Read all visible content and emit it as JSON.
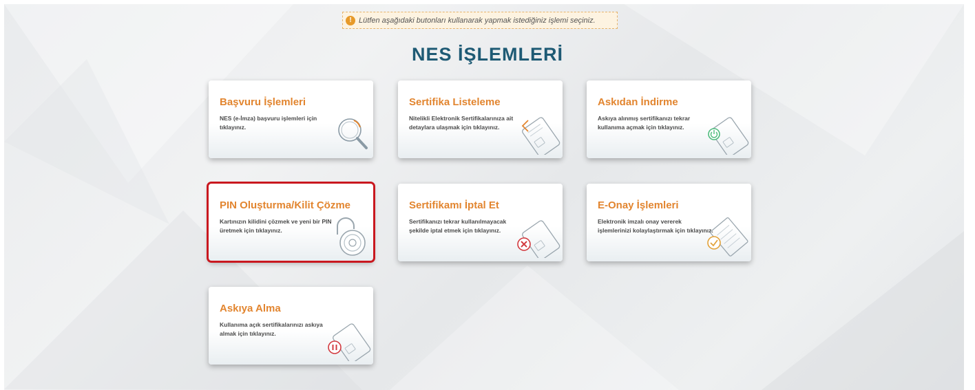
{
  "notice": {
    "text": "Lütfen aşağıdaki butonları kullanarak yapmak istediğiniz işlemi seçiniz.",
    "icon": "info-icon"
  },
  "page_title": "NES İŞLEMLERİ",
  "cards": [
    {
      "title": "Başvuru İşlemleri",
      "desc": "NES (e-İmza) başvuru işlemleri için tıklayınız.",
      "icon": "magnifier-icon"
    },
    {
      "title": "Sertifika Listeleme",
      "desc": "Nitelikli Elektronik Sertifikalarınıza ait detaylara ulaşmak için tıklayınız.",
      "icon": "card-list-icon"
    },
    {
      "title": "Askıdan İndirme",
      "desc": "Askıya alınmış sertifikanızı tekrar kullanıma açmak için tıklayınız.",
      "icon": "card-power-icon"
    },
    {
      "title": "PIN Oluşturma/Kilit Çözme",
      "desc": "Kartınızın kilidini çözmek ve yeni bir PIN üretmek için tıklayınız.",
      "icon": "padlock-icon"
    },
    {
      "title": "Sertifikamı İptal Et",
      "desc": "Sertifikanızı tekrar kullanılmayacak şekilde iptal etmek için tıklayınız.",
      "icon": "card-cancel-icon"
    },
    {
      "title": "E-Onay İşlemleri",
      "desc": "Elektronik imzalı onay vererek işlemlerinizi kolaylaştırmak için tıklayınız.",
      "icon": "document-check-icon"
    },
    {
      "title": "Askıya Alma",
      "desc": "Kullanıma açık sertifikalarınızı askıya almak için tıklayınız.",
      "icon": "card-pause-icon"
    }
  ],
  "colors": {
    "title": "#1e5a74",
    "card_title": "#e2852f",
    "highlight": "#c9181f",
    "notice_bg": "#fdf3e1"
  }
}
